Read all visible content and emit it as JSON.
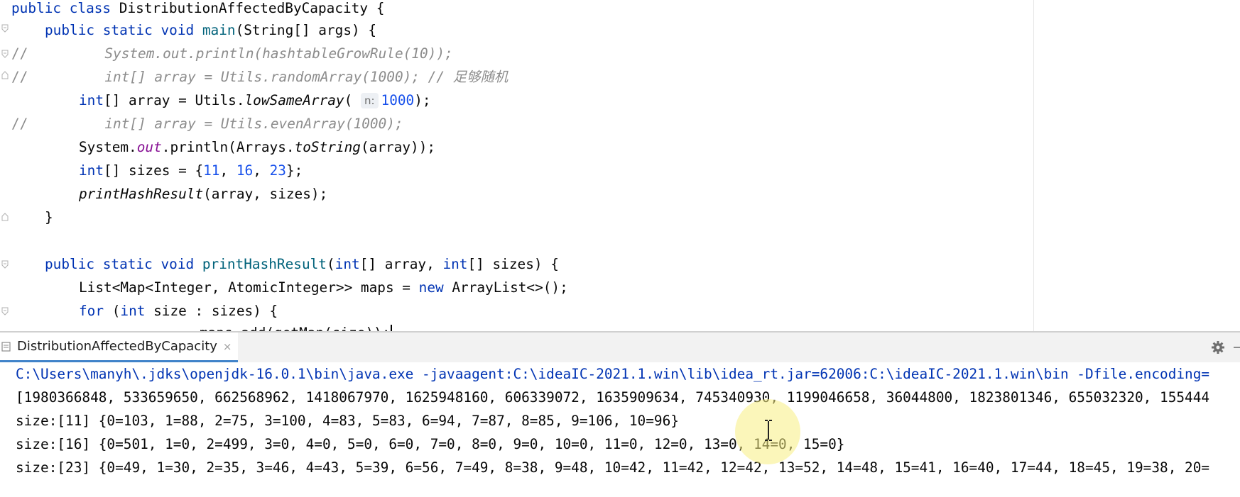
{
  "editor": {
    "lines": {
      "l1": {
        "kw1": "public",
        "kw2": "class",
        "name": "DistributionAffectedByCapacity",
        "brace": " {"
      },
      "l2": {
        "kw1": "public",
        "kw2": "static",
        "kw3": "void",
        "fn": "main",
        "rest": "(String[] args) {"
      },
      "l3": {
        "slashes": "//",
        "comment": "System.out.println(hashtableGrowRule(10));"
      },
      "l4": {
        "slashes": "//",
        "comment": "int[] array = Utils.randomArray(1000); // 足够随机"
      },
      "l5": {
        "kw": "int",
        "mid": "[] array = Utils.",
        "fn": "lowSameArray",
        "open": "(",
        "hint": "n:",
        "num": "1000",
        "close": ");"
      },
      "l6": {
        "slashes": "//",
        "comment": "int[] array = Utils.evenArray(1000);"
      },
      "l7": {
        "a": "System.",
        "field": "out",
        "b": ".println(Arrays.",
        "fn": "toString",
        "c": "(array));"
      },
      "l8": {
        "kw": "int",
        "a": "[] sizes = {",
        "n1": "11",
        "s1": ", ",
        "n2": "16",
        "s2": ", ",
        "n3": "23",
        "c": "};"
      },
      "l9": {
        "fn": "printHashResult",
        "rest": "(array, sizes);"
      },
      "l10": {
        "brace": "}"
      },
      "l12": {
        "kw1": "public",
        "kw2": "static",
        "kw3": "void",
        "fn": "printHashResult",
        "a": "(",
        "kw4": "int",
        "b": "[] array, ",
        "kw5": "int",
        "c": "[] sizes) {"
      },
      "l13": {
        "a": "List<Map<Integer, AtomicInteger>> maps = ",
        "kw": "new",
        "b": " ArrayList<>();"
      },
      "l14": {
        "kw1": "for",
        "a": " (",
        "kw2": "int",
        "b": " size : sizes) {"
      },
      "l15": {
        "partial": "maps.add(getMap(size));"
      }
    }
  },
  "run_panel": {
    "tab_label": "DistributionAffectedByCapacity",
    "close_glyph": "×",
    "console": {
      "cmd": "C:\\Users\\manyh\\.jdks\\openjdk-16.0.1\\bin\\java.exe -javaagent:C:\\ideaIC-2021.1.win\\lib\\idea_rt.jar=62006:C:\\ideaIC-2021.1.win\\bin -Dfile.encoding=",
      "array": "[1980366848, 533659650, 662568962, 1418067970, 1625948160, 606339072, 1635909634, 745340930, 1199046658, 36044800, 1823801346, 655032320, 155444",
      "size11": "size:[11] {0=103, 1=88, 2=75, 3=100, 4=83, 5=83, 6=94, 7=87, 8=85, 9=106, 10=96}",
      "size16": "size:[16] {0=501, 1=0, 2=499, 3=0, 4=0, 5=0, 6=0, 7=0, 8=0, 9=0, 10=0, 11=0, 12=0, 13=0, 14=0, 15=0}",
      "size23": "size:[23] {0=49, 1=30, 2=35, 3=46, 4=43, 5=39, 6=56, 7=49, 8=38, 9=48, 10=42, 11=42, 12=42, 13=52, 14=48, 15=41, 16=40, 17=44, 18=45, 19=38, 20="
    }
  },
  "icons": {
    "fold": "fold-marker-icon",
    "settings": "gear-icon",
    "run_config": "run-config-icon",
    "mouse_cursor": "text-cursor-icon"
  },
  "colors": {
    "keyword": "#0033b3",
    "number": "#1750eb",
    "method": "#00627a",
    "comment": "#8c8c8c",
    "static_field": "#871094",
    "tab_underline": "#4083c9"
  }
}
